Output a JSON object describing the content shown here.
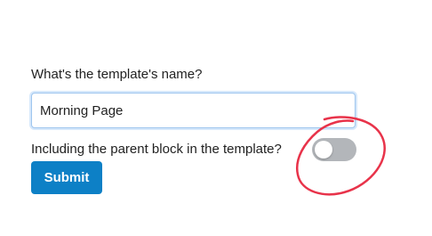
{
  "form": {
    "name_label": "What's the template's name?",
    "name_value": "Morning Page",
    "include_parent_label": "Including the parent block in the template?",
    "include_parent_on": false,
    "submit_label": "Submit"
  },
  "colors": {
    "submit_bg": "#0d80c6",
    "toggle_off_bg": "#b3b6ba",
    "annotation": "#e8334a"
  },
  "icons": {
    "annotation": "red-circle-annotation"
  }
}
